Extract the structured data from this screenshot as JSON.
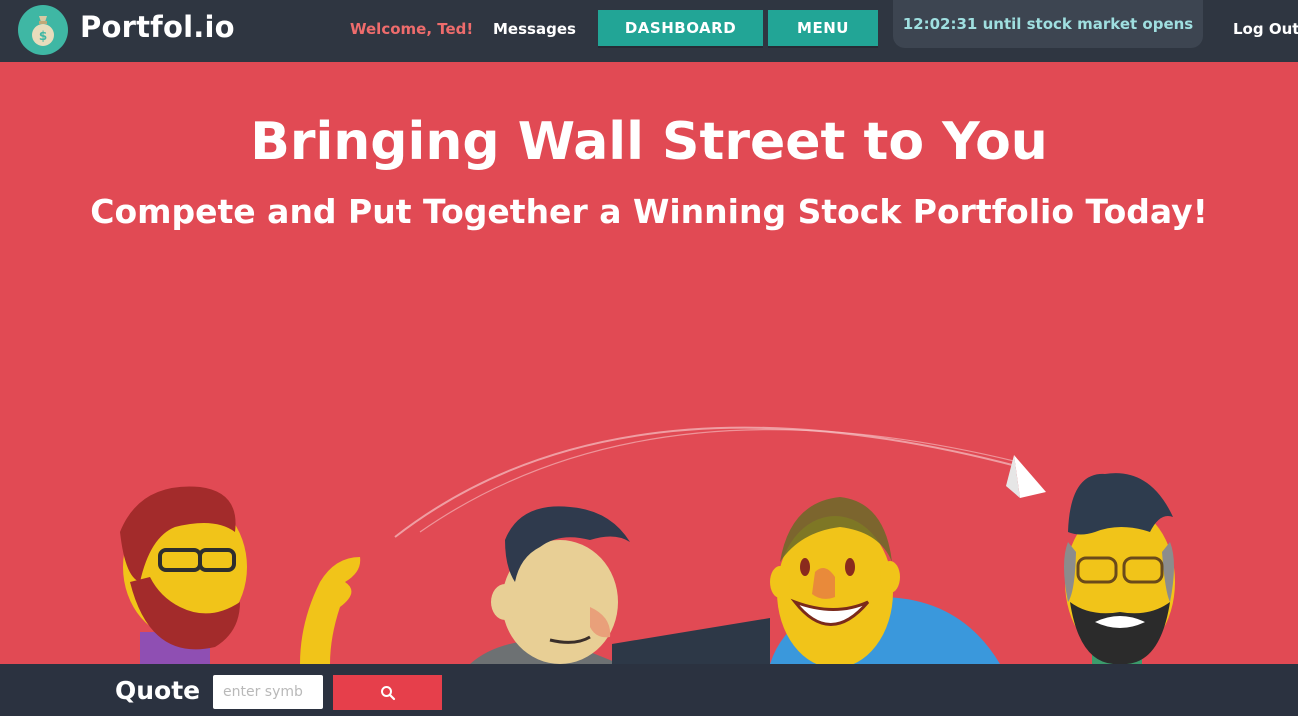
{
  "brand": {
    "name": "Portfol.io",
    "logo_icon": "money-bag-icon"
  },
  "nav": {
    "welcome": "Welcome, Ted!",
    "messages": "Messages",
    "dashboard": "DASHBOARD",
    "menu": "MENU",
    "countdown": "12:02:31 until stock market opens",
    "logout": "Log Out"
  },
  "hero": {
    "title": "Bringing Wall Street to You",
    "subtitle": "Compete and Put Together a Winning Stock Portfolio Today!"
  },
  "quote": {
    "label": "Quote",
    "placeholder": "enter symb",
    "search_icon": "search-icon"
  },
  "colors": {
    "nav_bg": "#2f3641",
    "hero_bg": "#e14a54",
    "accent_teal": "#22a596",
    "welcome_red": "#ee6c6c",
    "countdown_text": "#9fdfe0",
    "quote_button": "#e63f4b"
  }
}
